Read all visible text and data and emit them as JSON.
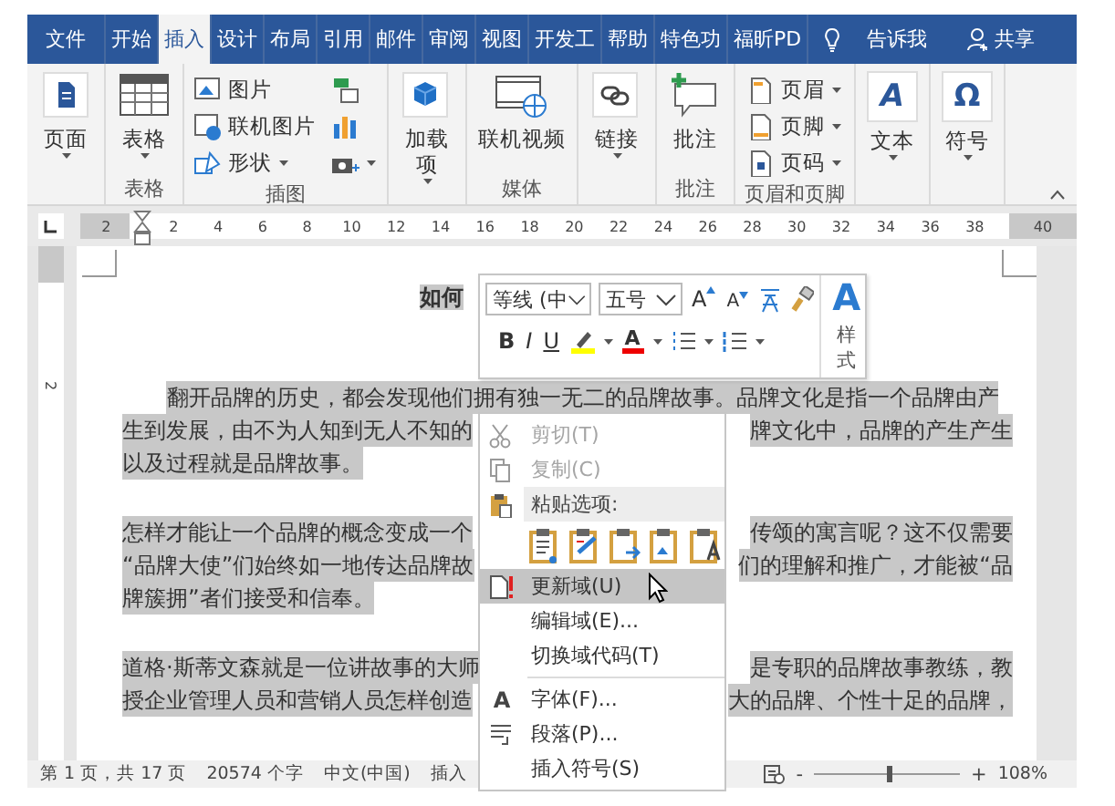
{
  "tabs": [
    {
      "label": "文件",
      "selected": false
    },
    {
      "label": "开始",
      "selected": false
    },
    {
      "label": "插入",
      "selected": true
    },
    {
      "label": "设计",
      "selected": false
    },
    {
      "label": "布局",
      "selected": false
    },
    {
      "label": "引用",
      "selected": false
    },
    {
      "label": "邮件",
      "selected": false
    },
    {
      "label": "审阅",
      "selected": false
    },
    {
      "label": "视图",
      "selected": false
    },
    {
      "label": "开发工",
      "selected": false
    },
    {
      "label": "帮助",
      "selected": false
    },
    {
      "label": "特色功",
      "selected": false
    },
    {
      "label": "福昕PD",
      "selected": false
    }
  ],
  "tell_me": "告诉我",
  "share": "共享",
  "ribbon_groups": [
    {
      "items": [
        {
          "kind": "large",
          "label": "页面",
          "dropdown": true
        }
      ]
    },
    {
      "label": "表格",
      "items": [
        {
          "kind": "large",
          "label": "表格",
          "dropdown": true
        }
      ]
    },
    {
      "label": "插图",
      "items": [
        {
          "kind": "small",
          "label": "图片",
          "dropdown": false
        },
        {
          "kind": "small",
          "label": "联机图片",
          "dropdown": false
        },
        {
          "kind": "small",
          "label": "形状",
          "dropdown": true
        },
        {
          "kind": "mini",
          "dropdown": false
        },
        {
          "kind": "mini",
          "dropdown": false
        },
        {
          "kind": "mini",
          "dropdown": true
        }
      ]
    },
    {
      "items": [
        {
          "kind": "large",
          "label": "加载项",
          "dropdown": true
        }
      ]
    },
    {
      "label": "媒体",
      "items": [
        {
          "kind": "large",
          "label": "联机视频",
          "dropdown": false
        }
      ]
    },
    {
      "items": [
        {
          "kind": "large",
          "label": "链接",
          "dropdown": true
        }
      ]
    },
    {
      "label": "批注",
      "items": [
        {
          "kind": "large",
          "label": "批注",
          "dropdown": false
        }
      ]
    },
    {
      "label": "页眉和页脚",
      "items": [
        {
          "kind": "small",
          "label": "页眉",
          "dropdown": true
        },
        {
          "kind": "small",
          "label": "页脚",
          "dropdown": true
        },
        {
          "kind": "small",
          "label": "页码",
          "dropdown": true
        }
      ]
    },
    {
      "items": [
        {
          "kind": "large",
          "label": "文本",
          "glyph": "A",
          "dropdown": true
        }
      ]
    },
    {
      "items": [
        {
          "kind": "large",
          "label": "符号",
          "glyph": "Ω",
          "dropdown": true
        }
      ]
    }
  ],
  "horizontal_ruler": [
    "2",
    "2",
    "4",
    "6",
    "8",
    "10",
    "12",
    "14",
    "16",
    "18",
    "20",
    "22",
    "24",
    "26",
    "28",
    "30",
    "32",
    "34",
    "36",
    "38",
    "40"
  ],
  "vertical_ruler": [
    "2"
  ],
  "document": {
    "title": {
      "text": "如何",
      "highlighted": true
    },
    "paragraphs": [
      {
        "first_line_indent": true,
        "highlighted": true,
        "lines": [
          {
            "left": "翻开品牌的历史，都会发现他们拥有独一无二的品牌故事。品牌文化是指一个品牌由产"
          },
          {
            "left": "生到发展，由不为人知到无人不知的",
            "right": "牌文化中，品牌的产生产生"
          },
          {
            "left": "以及过程就是品牌故事。"
          }
        ]
      },
      {
        "first_line_indent": false,
        "highlighted": true,
        "lines": [
          {
            "left": "怎样才能让一个品牌的概念变成一个",
            "right": "传颂的寓言呢？这不仅需要"
          },
          {
            "left": "“品牌大使”们始终如一地传达品牌故",
            "right": "们的理解和推广，才能被“品"
          },
          {
            "left": "牌簇拥”者们接受和信奉。"
          }
        ]
      },
      {
        "first_line_indent": false,
        "highlighted": true,
        "lines": [
          {
            "left": "道格·斯蒂文森就是一位讲故事的大师",
            "right": "是专职的品牌故事教练，教"
          },
          {
            "left": "授企业管理人员和营销人员怎样创造",
            "right": "大的品牌、个性十足的品牌，"
          }
        ]
      }
    ]
  },
  "mini_toolbar": {
    "font": "等线 (中",
    "size": "五号",
    "grow_glyph": "A",
    "shrink_glyph": "A",
    "bold": "B",
    "italic": "I",
    "underline": "U",
    "font_color_glyph": "A",
    "styles_glyph": "A",
    "styles_label": "样式"
  },
  "context_menu": [
    {
      "kind": "command",
      "label": "剪切(T)",
      "disabled": true,
      "selected": false
    },
    {
      "kind": "command",
      "label": "复制(C)",
      "disabled": true,
      "selected": false
    },
    {
      "kind": "header",
      "label": "粘贴选项:"
    },
    {
      "kind": "paste_options"
    },
    {
      "kind": "command",
      "label": "更新域(U)",
      "disabled": false,
      "selected": true
    },
    {
      "kind": "command",
      "label": "编辑域(E)...",
      "disabled": false,
      "selected": false
    },
    {
      "kind": "command",
      "label": "切换域代码(T)",
      "disabled": false,
      "selected": false
    },
    {
      "kind": "separator"
    },
    {
      "kind": "command",
      "label": "字体(F)...",
      "glyph": "A",
      "disabled": false,
      "selected": false
    },
    {
      "kind": "command",
      "label": "段落(P)...",
      "disabled": false,
      "selected": false
    },
    {
      "kind": "command",
      "label": "插入符号(S)",
      "disabled": false,
      "selected": false
    }
  ],
  "status_bar": {
    "items": [
      "第 1 页，共 17 页",
      "20574 个字",
      "中文(中国)",
      "插入"
    ],
    "minus": "-",
    "plus": "+",
    "zoom": "108%",
    "zoom_slider": {
      "level": 0.5
    }
  }
}
